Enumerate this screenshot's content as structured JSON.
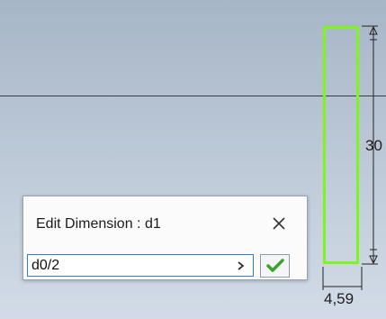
{
  "dialog": {
    "title": "Edit Dimension : d1",
    "input_value": "d0/2",
    "close_icon": "close-icon",
    "expand_icon": "chevron-right-icon",
    "confirm_icon": "checkmark-icon"
  },
  "canvas": {
    "dimension_height": "30",
    "dimension_width": "4,59",
    "sketch_color": "#7ff51c",
    "checkmark_color": "#3aa52a",
    "input_border_color": "#2f7bd6"
  }
}
